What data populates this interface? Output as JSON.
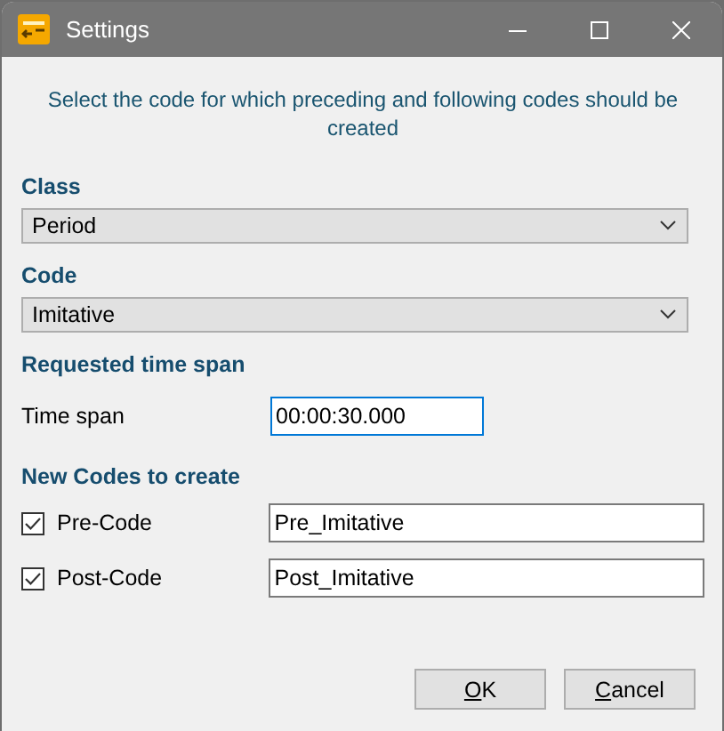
{
  "window": {
    "title": "Settings"
  },
  "instruction": "Select the code for which preceding and following codes should be created",
  "class": {
    "label": "Class",
    "value": "Period"
  },
  "code": {
    "label": "Code",
    "value": "Imitative"
  },
  "time_span": {
    "heading": "Requested time span",
    "label": "Time span",
    "value": "00:00:30.000"
  },
  "new_codes": {
    "heading": "New Codes to create",
    "items": [
      {
        "label": "Pre-Code",
        "checked": true,
        "value": "Pre_Imitative"
      },
      {
        "label": "Post-Code",
        "checked": true,
        "value": "Post_Imitative"
      }
    ]
  },
  "buttons": [
    "OK",
    "Cancel"
  ]
}
